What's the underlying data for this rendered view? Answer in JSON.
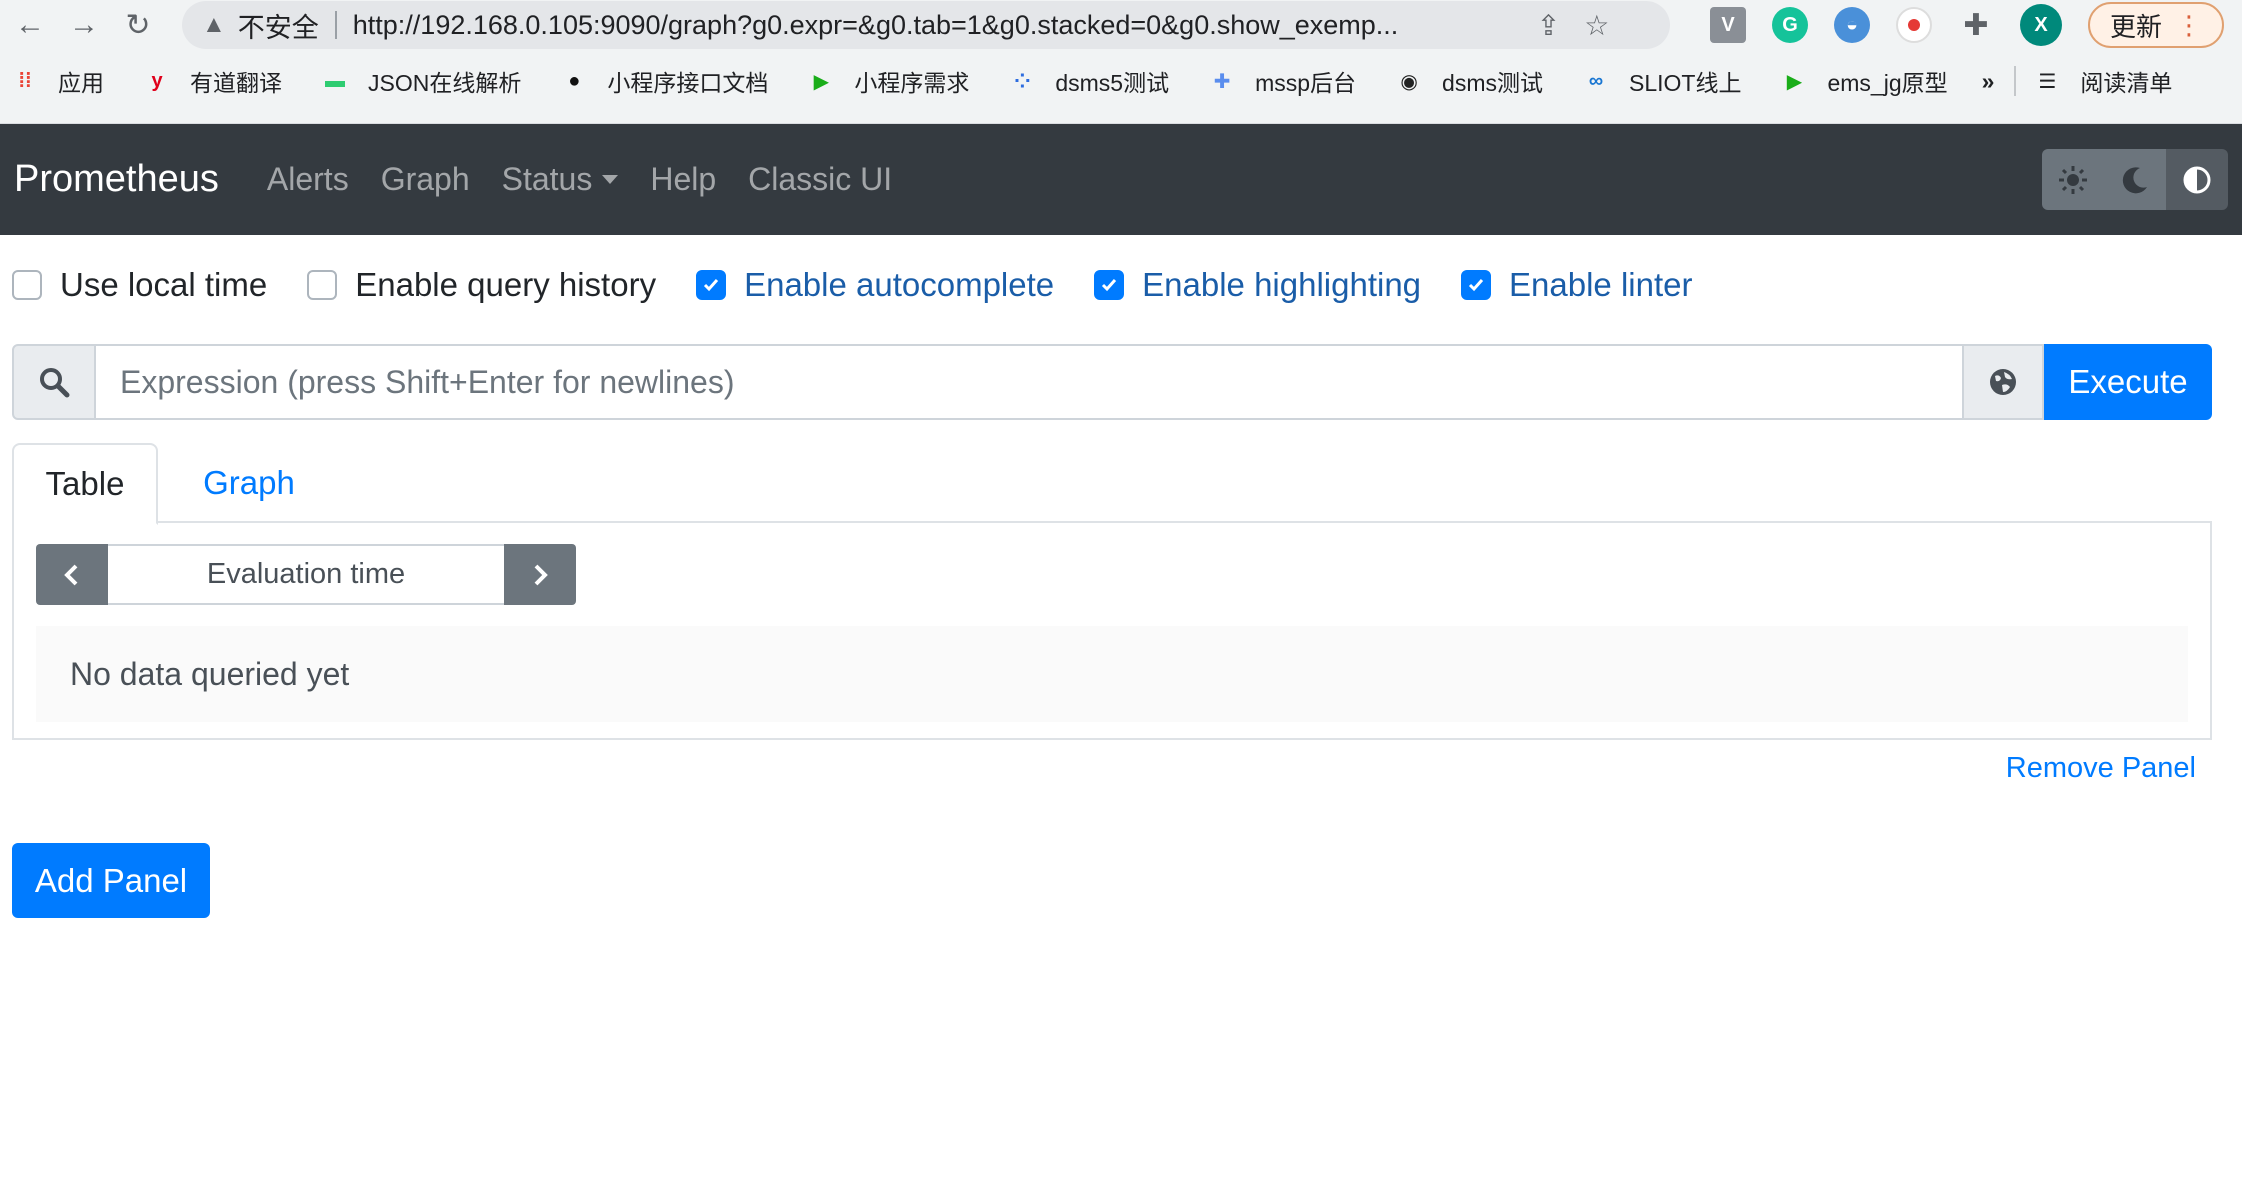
{
  "browser": {
    "security_label": "不安全",
    "url": "http://192.168.0.105:9090/graph?g0.expr=&g0.tab=1&g0.stacked=0&g0.show_exemp...",
    "update_label": "更新",
    "avatar_letter": "X",
    "bookmarks": [
      {
        "label": "应用",
        "icon": "apps-grid-icon",
        "color": "#ea4335"
      },
      {
        "label": "有道翻译",
        "icon": "youdao-icon",
        "color": "#e0001b"
      },
      {
        "label": "JSON在线解析",
        "icon": "json-icon",
        "color": "#2ecc71"
      },
      {
        "label": "小程序接口文档",
        "icon": "feather-icon",
        "color": "#111111"
      },
      {
        "label": "小程序需求",
        "icon": "play-icon",
        "color": "#1aad19"
      },
      {
        "label": "dsms5测试",
        "icon": "dots-icon",
        "color": "#2d6cdf"
      },
      {
        "label": "mssp后台",
        "icon": "plus-page-icon",
        "color": "#5a8dee"
      },
      {
        "label": "dsms测试",
        "icon": "globe-icon",
        "color": "#222222"
      },
      {
        "label": "SLIOT线上",
        "icon": "cloud-link-icon",
        "color": "#1976d2"
      },
      {
        "label": "ems_jg原型",
        "icon": "play-icon",
        "color": "#1aad19"
      }
    ],
    "more_label": "»",
    "reading_list_label": "阅读清单"
  },
  "navbar": {
    "brand": "Prometheus",
    "links": [
      "Alerts",
      "Graph",
      "Status",
      "Help",
      "Classic UI"
    ]
  },
  "options": [
    {
      "label": "Use local time",
      "checked": false
    },
    {
      "label": "Enable query history",
      "checked": false
    },
    {
      "label": "Enable autocomplete",
      "checked": true
    },
    {
      "label": "Enable highlighting",
      "checked": true
    },
    {
      "label": "Enable linter",
      "checked": true
    }
  ],
  "query": {
    "placeholder": "Expression (press Shift+Enter for newlines)",
    "execute_label": "Execute"
  },
  "tabs": {
    "table": "Table",
    "graph": "Graph"
  },
  "panel": {
    "eval_placeholder": "Evaluation time",
    "no_data": "No data queried yet"
  },
  "remove_panel": "Remove Panel",
  "add_panel": "Add Panel",
  "colors": {
    "primary": "#007bff",
    "navbar": "#343a40",
    "secondary": "#6c757d"
  }
}
